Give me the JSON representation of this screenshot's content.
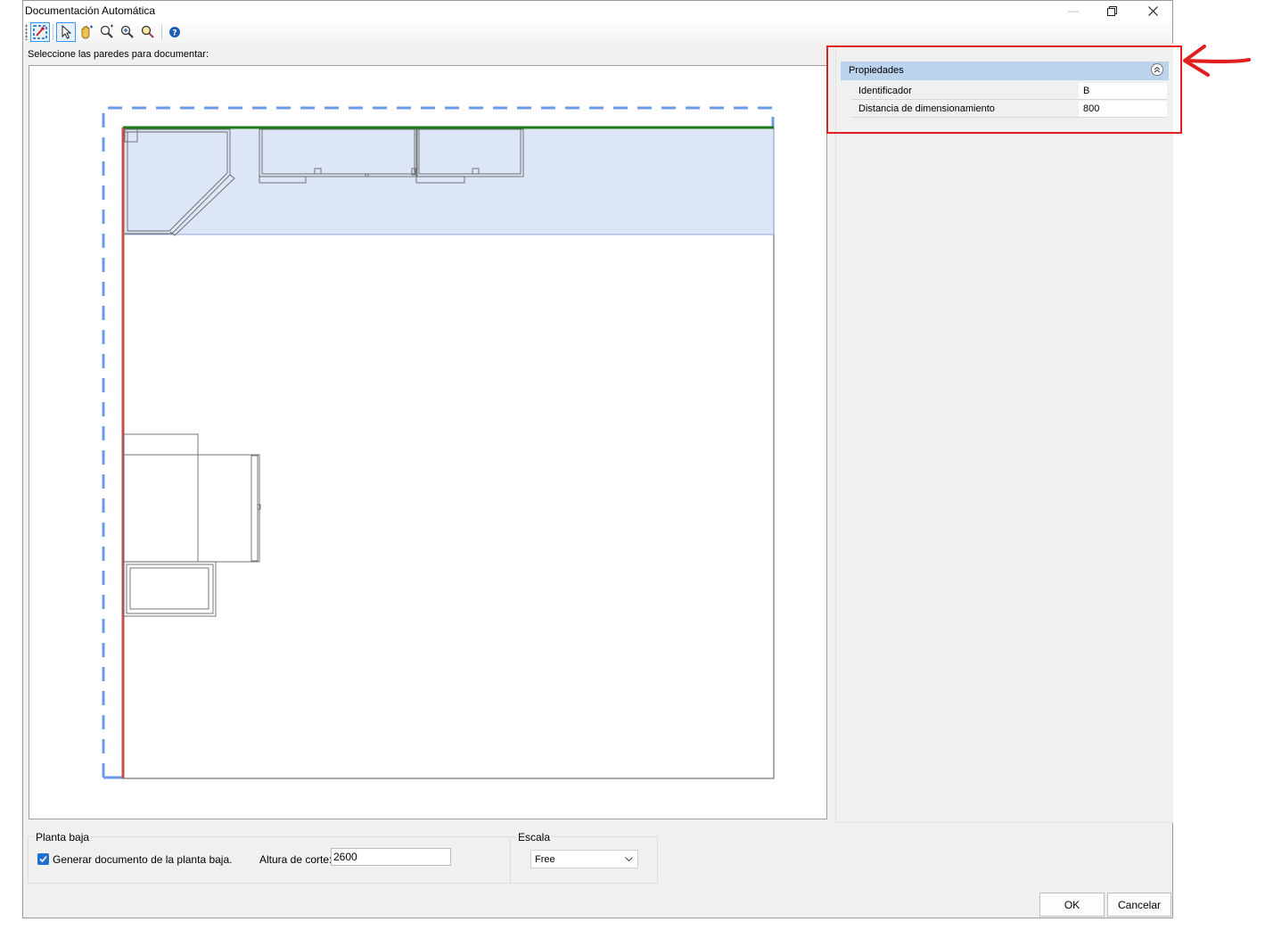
{
  "window": {
    "title": "Documentación Automática",
    "minimize_glyph": "—",
    "restore_icon": "restore-icon",
    "close_icon": "close-icon"
  },
  "toolbar": {
    "items": [
      {
        "name": "select-walls-tool",
        "icon": "wall-select-icon",
        "active": true
      },
      {
        "name": "pointer-tool",
        "icon": "pointer-icon",
        "active": true
      },
      {
        "name": "pan-tool",
        "icon": "hand-icon",
        "active": false
      },
      {
        "name": "zoom-window-tool",
        "icon": "zoom-window-icon",
        "active": false
      },
      {
        "name": "zoom-in-tool",
        "icon": "zoom-in-icon",
        "active": false
      },
      {
        "name": "zoom-extents-tool",
        "icon": "zoom-extents-icon",
        "active": false
      },
      {
        "name": "help-tool",
        "icon": "help-icon",
        "active": false
      }
    ]
  },
  "instruction": "Seleccione las paredes para documentar:",
  "properties": {
    "header": "Propiedades",
    "rows": [
      {
        "label": "Identificador",
        "value": "B"
      },
      {
        "label": "Distancia de dimensionamiento",
        "value": "800"
      }
    ]
  },
  "ground_floor": {
    "legend": "Planta baja",
    "checkbox_label": "Generar documento de la planta baja.",
    "checked": true,
    "cut_height_label": "Altura de corte:",
    "cut_height_value": "2600"
  },
  "scale": {
    "legend": "Escala",
    "selected": "Free"
  },
  "buttons": {
    "ok": "OK",
    "cancel": "Cancelar"
  },
  "colors": {
    "selected_wall": "#1a7a1a",
    "wall_outline": "#6b9be8",
    "highlight_zone": "#dde6f6",
    "left_wall": "#c0504d",
    "annotation": "#e02020",
    "props_header": "#bcd3ee"
  }
}
